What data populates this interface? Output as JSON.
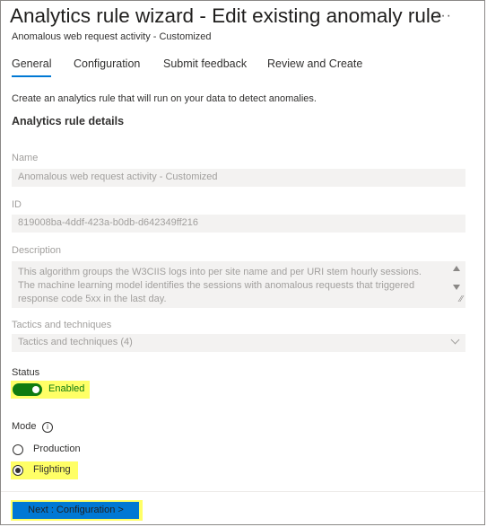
{
  "header": {
    "title": "Analytics rule wizard - Edit existing anomaly rule",
    "subtitle": "Anomalous web request activity - Customized",
    "more_label": "···"
  },
  "tabs": [
    {
      "label": "General",
      "active": true
    },
    {
      "label": "Configuration",
      "active": false
    },
    {
      "label": "Submit feedback",
      "active": false
    },
    {
      "label": "Review and Create",
      "active": false
    }
  ],
  "intro": "Create an analytics rule that will run on your data to detect anomalies.",
  "section_title": "Analytics rule details",
  "fields": {
    "name": {
      "label": "Name",
      "value": "Anomalous web request activity - Customized"
    },
    "id": {
      "label": "ID",
      "value": "819008ba-4ddf-423a-b0db-d642349ff216"
    },
    "description": {
      "label": "Description",
      "value": "This algorithm groups the W3CIIS logs into per site name and per URI stem hourly sessions. The machine learning model identifies the sessions with anomalous requests that triggered response code 5xx in the last day."
    },
    "tactics": {
      "label": "Tactics and techniques",
      "value": "Tactics and techniques",
      "count": "(4)"
    }
  },
  "status": {
    "label": "Status",
    "toggle_label": "Enabled",
    "on": true
  },
  "mode": {
    "label": "Mode",
    "options": [
      {
        "label": "Production",
        "selected": false
      },
      {
        "label": "Flighting",
        "selected": true
      }
    ]
  },
  "footer": {
    "next_label": "Next : Configuration >"
  },
  "colors": {
    "accent": "#0078d4",
    "toggle_on": "#107c10",
    "highlight": "#ffff66"
  }
}
